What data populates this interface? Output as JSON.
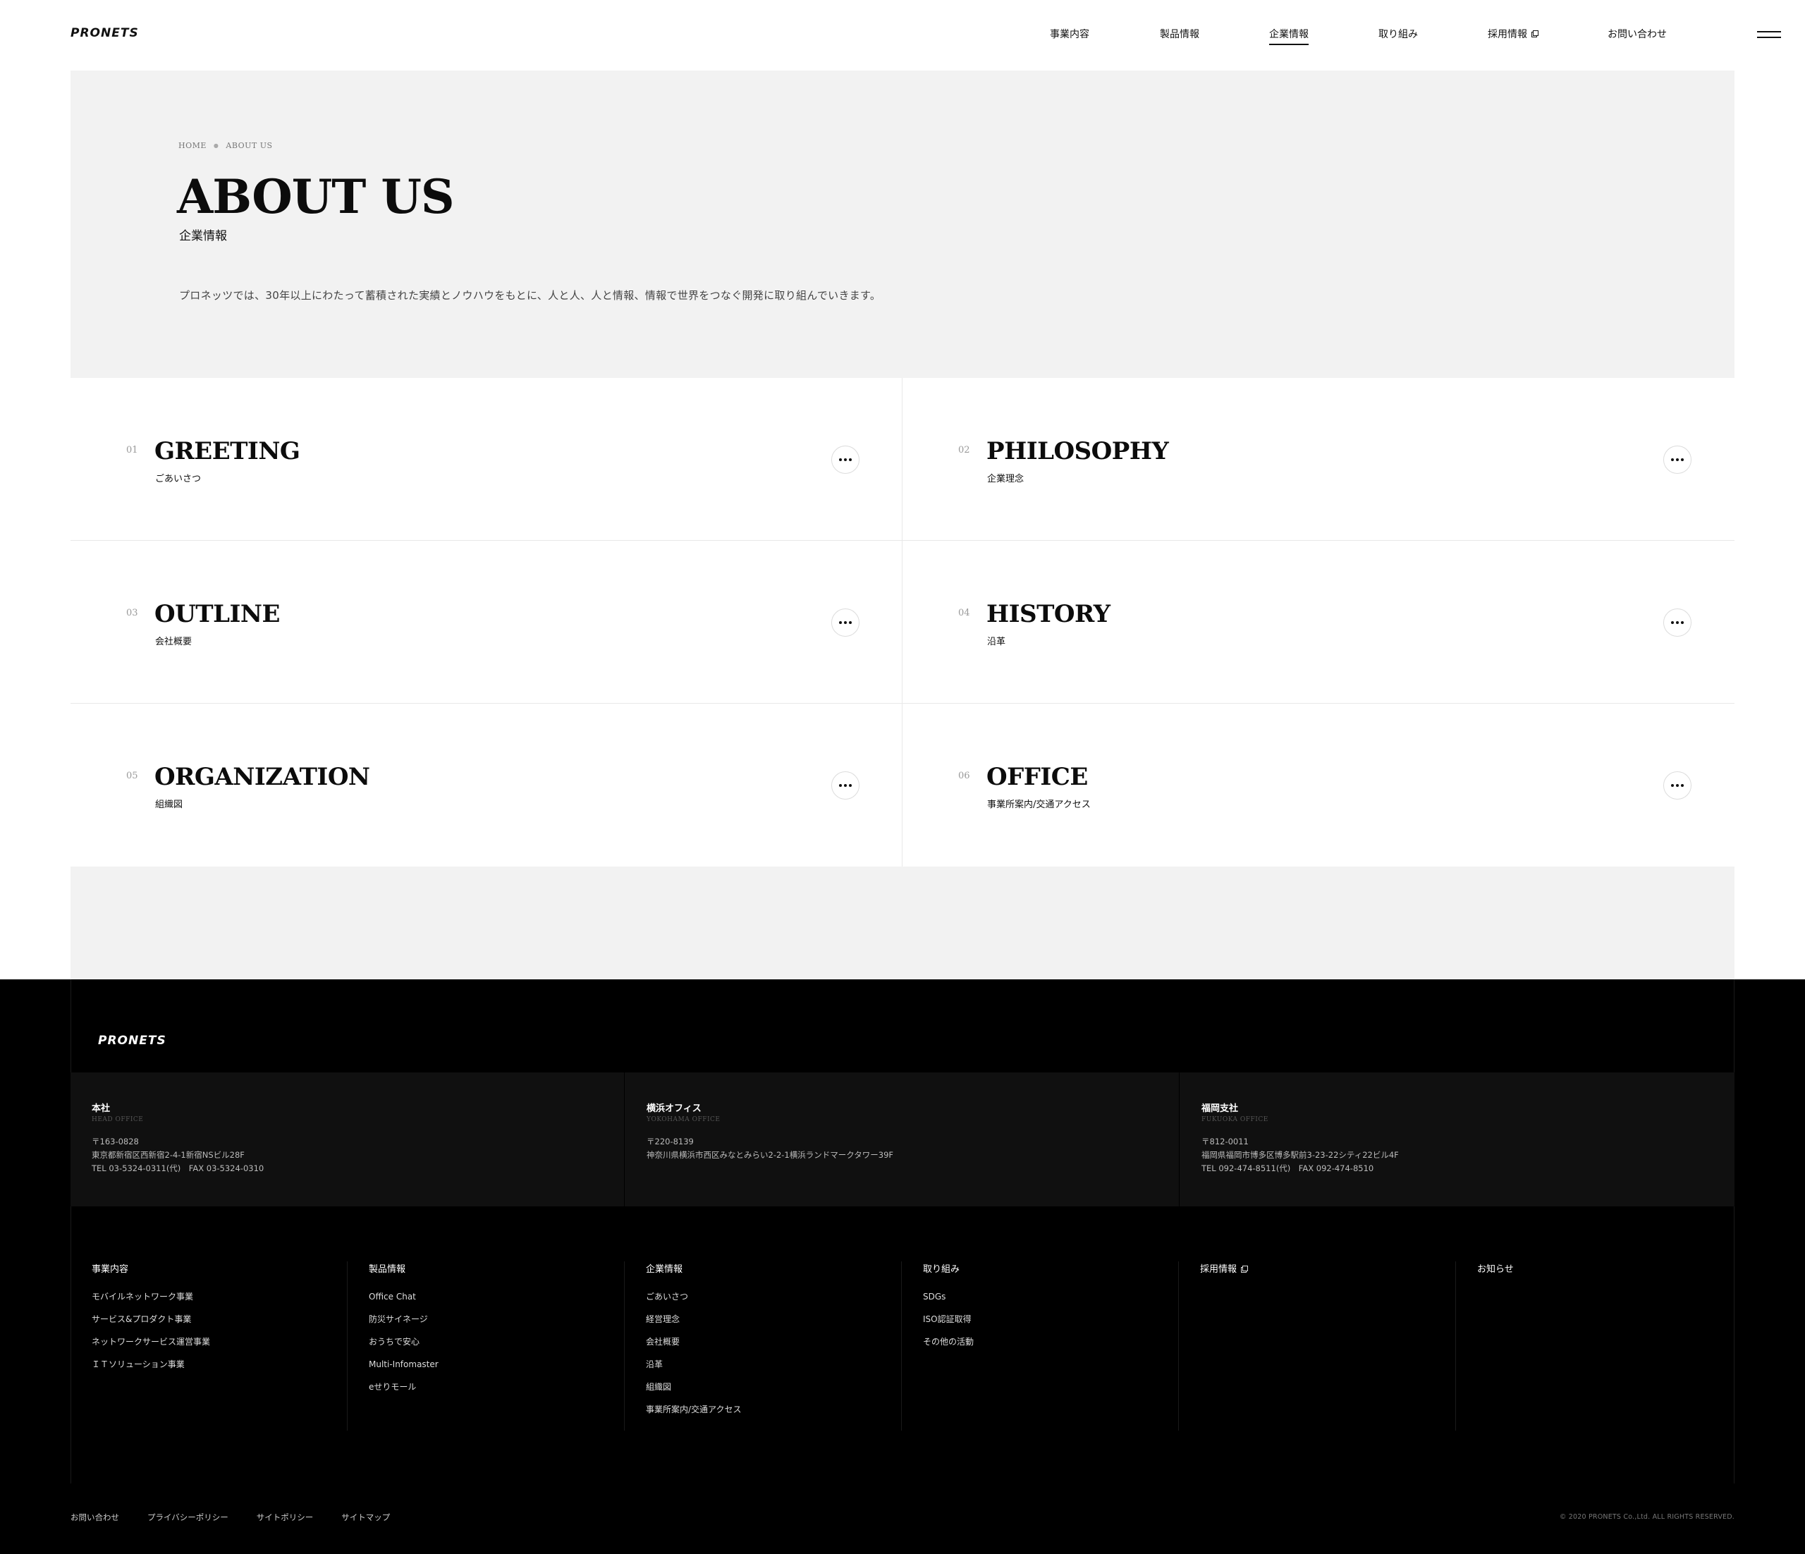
{
  "brand": {
    "name": "PRONETS"
  },
  "nav": {
    "items": [
      {
        "label": "事業内容"
      },
      {
        "label": "製品情報"
      },
      {
        "label": "企業情報"
      },
      {
        "label": "取り組み"
      },
      {
        "label": "採用情報"
      },
      {
        "label": "お問い合わせ"
      }
    ],
    "active": "企業情報"
  },
  "breadcrumb": {
    "home": "HOME",
    "current": "ABOUT US"
  },
  "hero": {
    "title": "ABOUT US",
    "subtitle": "企業情報",
    "lead": "プロネッツでは、30年以上にわたって蓄積された実績とノウハウをもとに、人と人、人と情報、情報で世界をつなぐ開発に取り組んでいきます。"
  },
  "sections": [
    {
      "num": "01",
      "title": "GREETING",
      "sub": "ごあいさつ"
    },
    {
      "num": "02",
      "title": "PHILOSOPHY",
      "sub": "企業理念"
    },
    {
      "num": "03",
      "title": "OUTLINE",
      "sub": "会社概要"
    },
    {
      "num": "04",
      "title": "HISTORY",
      "sub": "沿革"
    },
    {
      "num": "05",
      "title": "ORGANIZATION",
      "sub": "組織図"
    },
    {
      "num": "06",
      "title": "OFFICE",
      "sub": "事業所案内/交通アクセス"
    }
  ],
  "offices": [
    {
      "title": "本社",
      "en": "HEAD OFFICE",
      "zip": "〒163-0828",
      "address": "東京都新宿区西新宿2-4-1新宿NSビル28F",
      "tel": "TEL 03-5324-0311(代)　FAX 03-5324-0310"
    },
    {
      "title": "横浜オフィス",
      "en": "YOKOHAMA OFFICE",
      "zip": "〒220-8139",
      "address": "神奈川県横浜市西区みなとみらい2-2-1横浜ランドマークタワー39F",
      "tel": ""
    },
    {
      "title": "福岡支社",
      "en": "FUKUOKA OFFICE",
      "zip": "〒812-0011",
      "address": "福岡県福岡市博多区博多駅前3-23-22シティ22ビル4F",
      "tel": "TEL 092-474-8511(代)　FAX 092-474-8510"
    }
  ],
  "footer_columns": [
    {
      "heading": "事業内容",
      "links": [
        "モバイルネットワーク事業",
        "サービス&プロダクト事業",
        "ネットワークサービス運営事業",
        "ＩＴソリューション事業"
      ]
    },
    {
      "heading": "製品情報",
      "links": [
        "Office Chat",
        "防災サイネージ",
        "おうちで安心",
        "Multi-Infomaster",
        "eせりモール"
      ]
    },
    {
      "heading": "企業情報",
      "links": [
        "ごあいさつ",
        "経営理念",
        "会社概要",
        "沿革",
        "組織図",
        "事業所案内/交通アクセス"
      ]
    },
    {
      "heading": "取り組み",
      "links": [
        "SDGs",
        "ISO認証取得",
        "その他の活動"
      ]
    },
    {
      "heading": "採用情報",
      "links": []
    },
    {
      "heading": "お知らせ",
      "links": []
    }
  ],
  "bottom_links": [
    "お問い合わせ",
    "プライバシーポリシー",
    "サイトポリシー",
    "サイトマップ"
  ],
  "copyright": "© 2020 PRONETS Co.,Ltd. ALL RIGHTS RESERVED."
}
